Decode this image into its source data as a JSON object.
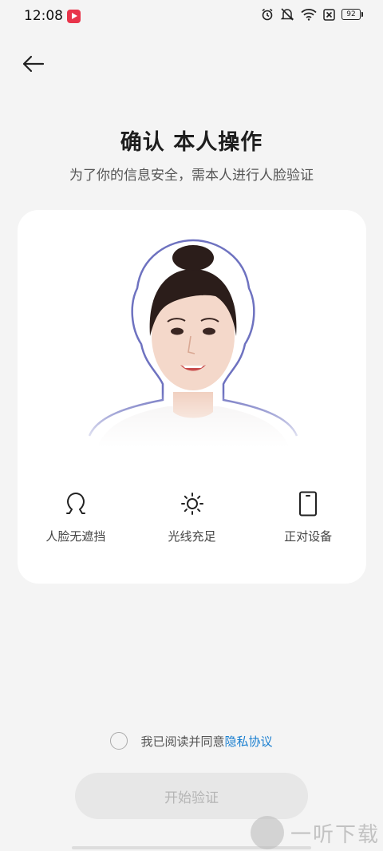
{
  "status_bar": {
    "time": "12:08",
    "battery": "92"
  },
  "header": {
    "title": "确认  本人操作",
    "subtitle": "为了你的信息安全，需本人进行人脸验证"
  },
  "tips": [
    {
      "icon": "face-outline-icon",
      "label": "人脸无遮挡"
    },
    {
      "icon": "sun-icon",
      "label": "光线充足"
    },
    {
      "icon": "phone-icon",
      "label": "正对设备"
    }
  ],
  "agreement": {
    "text": "我已阅读并同意",
    "link": "隐私协议"
  },
  "start_button": {
    "label": "开始验证"
  },
  "watermark": {
    "text": "一听下载"
  },
  "colors": {
    "background": "#f4f4f4",
    "card": "#ffffff",
    "link": "#1a7fd0",
    "button_disabled": "#e7e7e7",
    "face_outline": "#6e72c0"
  }
}
